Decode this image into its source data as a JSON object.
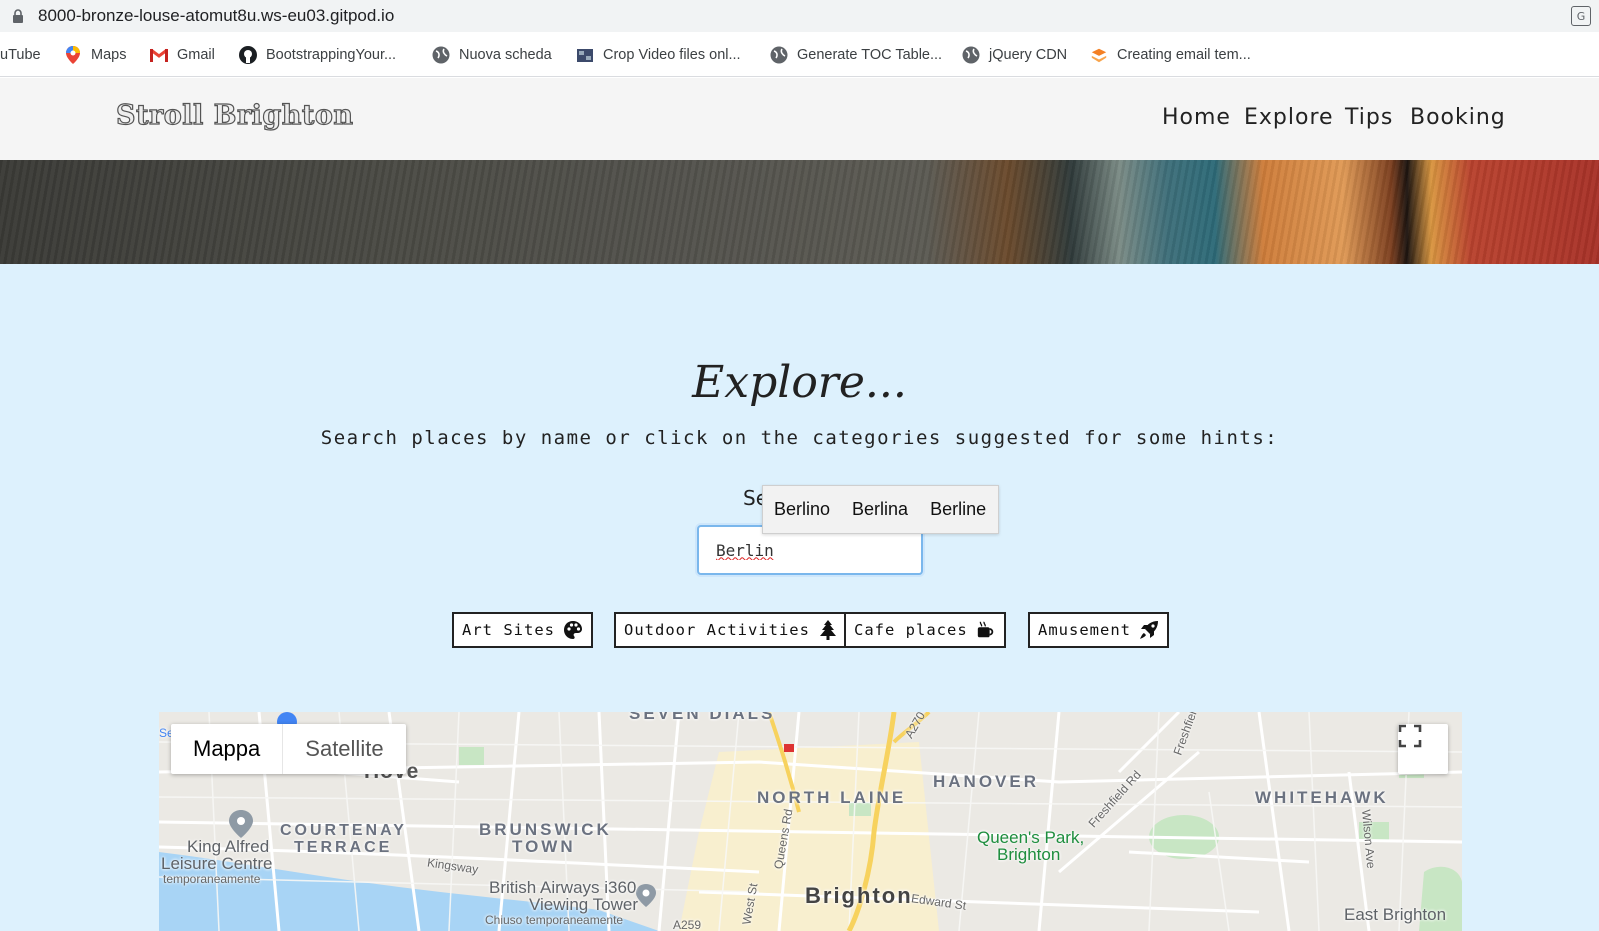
{
  "browser": {
    "url": "8000-bronze-louse-atomut8u.ws-eu03.gitpod.io",
    "bookmarks": [
      {
        "label": "uTube",
        "icon": "youtube-icon"
      },
      {
        "label": "Maps",
        "icon": "maps-pin-icon"
      },
      {
        "label": "Gmail",
        "icon": "gmail-icon"
      },
      {
        "label": "BootstrappingYour...",
        "icon": "github-icon"
      },
      {
        "label": "Nuova scheda",
        "icon": "globe-icon"
      },
      {
        "label": "Crop Video files onl...",
        "icon": "film-icon"
      },
      {
        "label": "Generate TOC Table...",
        "icon": "globe-icon"
      },
      {
        "label": "jQuery CDN",
        "icon": "globe-icon"
      },
      {
        "label": "Creating email tem...",
        "icon": "stack-icon"
      }
    ]
  },
  "header": {
    "logo": "Stroll Brighton",
    "nav": [
      "Home",
      "Explore",
      "Tips",
      "Booking"
    ]
  },
  "main": {
    "title": "Explore...",
    "subtitle": "Search places by name or click on the categories suggested for some hints:",
    "search_label": "Se",
    "search_value": "Berlin",
    "autocomplete": [
      "Berlino",
      "Berlina",
      "Berline"
    ],
    "categories": [
      {
        "label": "Art Sites",
        "icon": "palette-icon"
      },
      {
        "label": "Outdoor Activities",
        "icon": "tree-icon"
      },
      {
        "label": "Cafe places",
        "icon": "coffee-icon"
      },
      {
        "label": "Amusement",
        "icon": "rocket-icon"
      }
    ]
  },
  "map": {
    "toggle": [
      "Mappa",
      "Satellite"
    ],
    "labels": {
      "seven_dials": "SEVEN DIALS",
      "hove": "Hove",
      "north_laine": "NORTH LAINE",
      "hanover": "HANOVER",
      "whitehawk": "WHITEHAWK",
      "courtenay": "COURTENAY",
      "terrace": "TERRACE",
      "brunswick": "BRUNSWICK",
      "town": "TOWN",
      "king_alfred": "King Alfred",
      "leisure_centre": "Leisure Centre",
      "temp1": "temporaneamente",
      "queens_park": "Queen's Park,",
      "brighton_park": "Brighton",
      "brighton": "Brighton",
      "ba_i360": "British Airways i360",
      "viewing_tower": "Viewing Tower",
      "chiuso": "Chiuso temporaneamente",
      "east_brighton": "East Brighton",
      "kingsway": "Kingsway",
      "queens_rd": "Queens Rd",
      "west_st": "West St",
      "edward_st": "Edward St",
      "freshfield_rd": "Freshfield Rd",
      "freshfiel": "Freshfiel",
      "wilson_ave": "Wilson Ave",
      "a270": "A270",
      "a259": "A259",
      "se": "Se"
    }
  }
}
